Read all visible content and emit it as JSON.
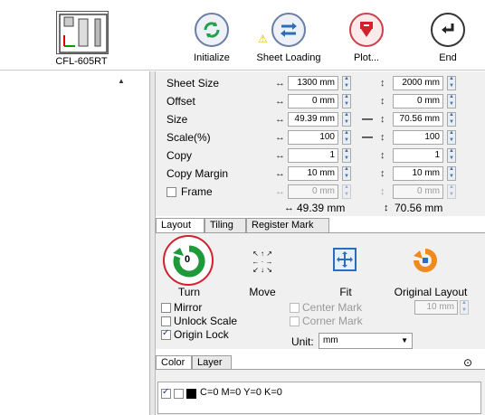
{
  "toolbar": {
    "device_label": "CFL-605RT",
    "initialize_label": "Initialize",
    "sheet_loading_label": "Sheet Loading",
    "plot_label": "Plot...",
    "end_label": "End"
  },
  "settings": {
    "rows": [
      {
        "label": "Sheet Size",
        "x": "1300 mm",
        "y": "2000 mm"
      },
      {
        "label": "Offset",
        "x": "0 mm",
        "y": "0 mm"
      },
      {
        "label": "Size",
        "x": "49.39 mm",
        "y": "70.56 mm"
      },
      {
        "label": "Scale(%)",
        "x": "100",
        "y": "100"
      },
      {
        "label": "Copy",
        "x": "1",
        "y": "1"
      },
      {
        "label": "Copy Margin",
        "x": "10 mm",
        "y": "10 mm"
      }
    ],
    "frame_label": "Frame",
    "frame_x": "0 mm",
    "frame_y": "0 mm",
    "summary_x": "49.39 mm",
    "summary_y": "70.56 mm"
  },
  "tabs": {
    "layout": "Layout",
    "tiling": "Tiling",
    "register_mark": "Register Mark"
  },
  "layout": {
    "turn_label": "Turn",
    "turn_value": "0",
    "move_label": "Move",
    "fit_label": "Fit",
    "original_layout_label": "Original Layout",
    "mirror_label": "Mirror",
    "unlock_scale_label": "Unlock Scale",
    "origin_lock_label": "Origin Lock",
    "center_mark_label": "Center Mark",
    "corner_mark_label": "Corner Mark",
    "original_layout_value": "10 mm",
    "unit_label": "Unit:",
    "unit_value": "mm"
  },
  "color_tabs": {
    "color": "Color",
    "layer": "Layer"
  },
  "color": {
    "item": "C=0 M=0 Y=0 K=0"
  },
  "accent": "#d3212b"
}
